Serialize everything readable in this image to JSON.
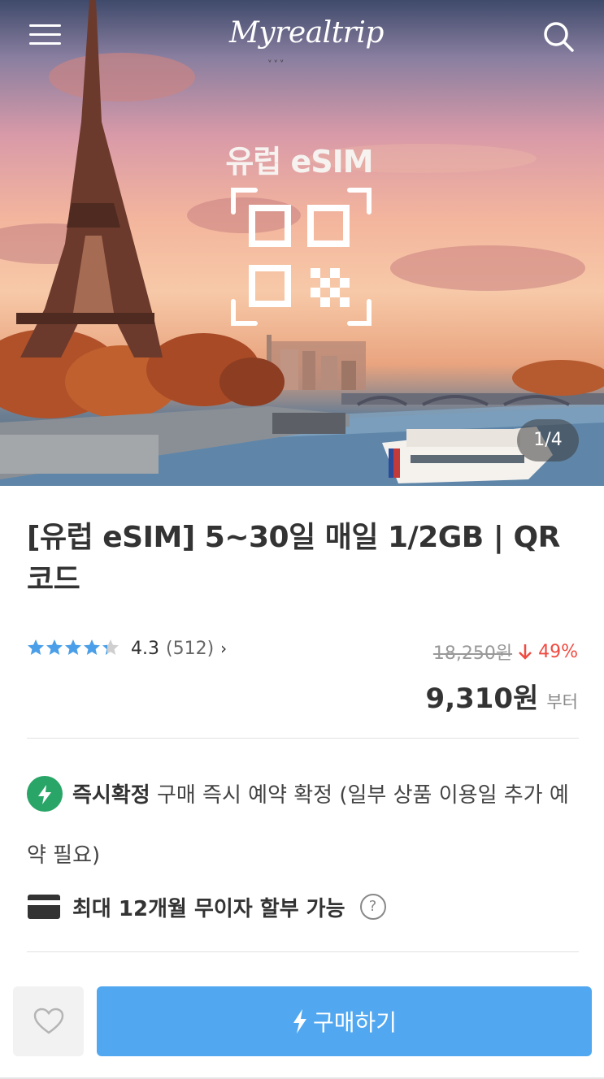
{
  "header": {
    "logo": "Myrealtrip",
    "menu_icon": "hamburger-icon",
    "search_icon": "search-icon"
  },
  "hero": {
    "overlay_title": "유럽 eSIM",
    "image_counter": "1/4"
  },
  "product": {
    "title": "[유럽 eSIM] 5~30일 매일 1/2GB | QR코드",
    "rating": {
      "stars": 4.3,
      "score": "4.3",
      "count": "(512)"
    },
    "price": {
      "original": "18,250원",
      "discount": "49%",
      "current": "9,310원",
      "suffix": "부터"
    },
    "instant_confirm": {
      "label": "즉시확정",
      "description": "구매 즉시 예약 확정 (일부 상품 이용일 추가 예약 필요)"
    },
    "installment": {
      "text": "최대 12개월 무이자 할부 가능"
    }
  },
  "actions": {
    "wishlist_icon": "heart-outline-icon",
    "buy_label": "구매하기"
  },
  "colors": {
    "accent": "#51a8f0",
    "star": "#4a9fe8",
    "discount": "#ef4b41",
    "confirm_badge": "#29a567"
  }
}
